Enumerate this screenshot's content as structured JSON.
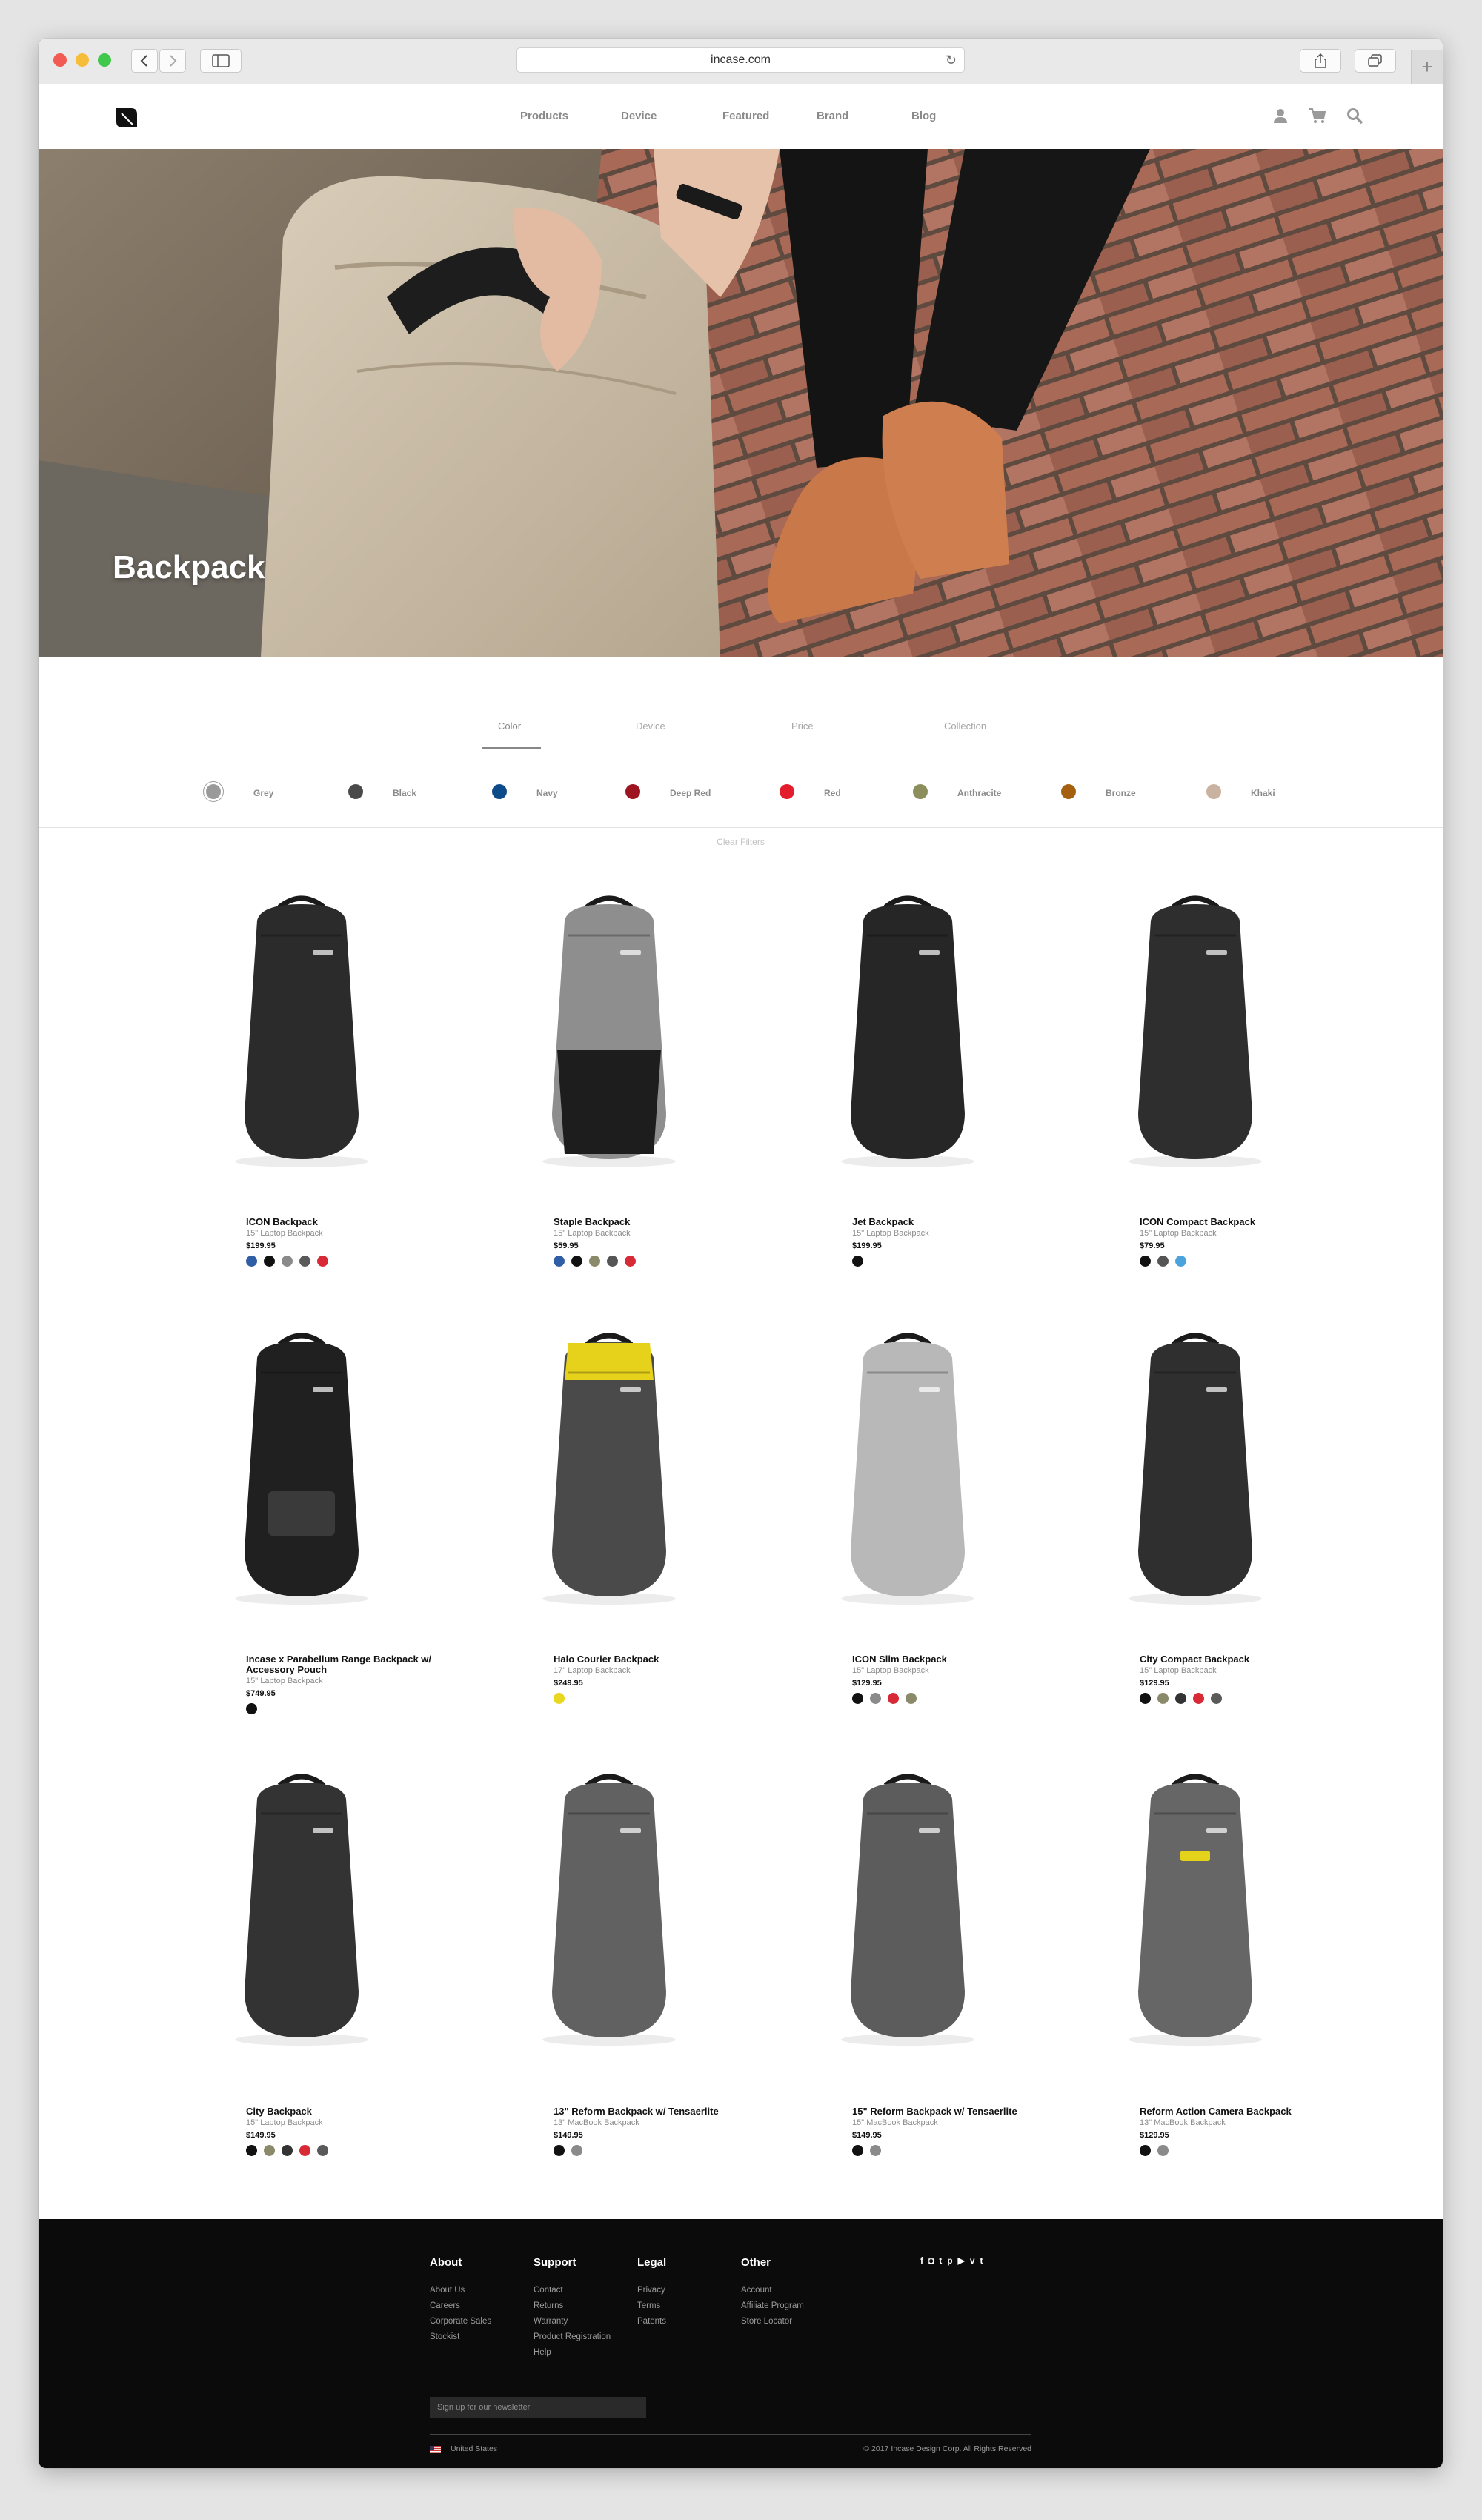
{
  "browser": {
    "url": "incase.com",
    "new_tab_symbol": "+"
  },
  "nav": {
    "links": [
      "Products",
      "Device",
      "Featured",
      "Brand",
      "Blog"
    ],
    "icons": [
      "user-icon",
      "cart-icon",
      "search-icon"
    ]
  },
  "hero": {
    "title": "Backpack"
  },
  "filters": {
    "tabs": [
      "Color",
      "Device",
      "Price",
      "Collection"
    ],
    "active_tab": "Color",
    "colors": [
      {
        "label": "Grey",
        "color": "#9a9a9a"
      },
      {
        "label": "Black",
        "color": "#4a4a4a"
      },
      {
        "label": "Navy",
        "color": "#0d4a8a"
      },
      {
        "label": "Deep Red",
        "color": "#9e1420"
      },
      {
        "label": "Red",
        "color": "#e41d2d"
      },
      {
        "label": "Anthracite",
        "color": "#8c8f5c"
      },
      {
        "label": "Bronze",
        "color": "#a5600f"
      },
      {
        "label": "Khaki",
        "color": "#c9b3a0"
      }
    ],
    "clear_label": "Clear Filters"
  },
  "products": [
    {
      "name": "ICON Backpack",
      "subtitle": "15\" Laptop Backpack",
      "price": "$199.95",
      "swatches": [
        "#2f5da6",
        "#111111",
        "#8a8a8a",
        "#5a5a5a",
        "#d82a36"
      ]
    },
    {
      "name": "Staple Backpack",
      "subtitle": "15\" Laptop Backpack",
      "price": "$59.95",
      "swatches": [
        "#2f5da6",
        "#111111",
        "#8a8a6a",
        "#555555",
        "#d82a36"
      ]
    },
    {
      "name": "Jet Backpack",
      "subtitle": "15\" Laptop Backpack",
      "price": "$199.95",
      "swatches": [
        "#111111"
      ]
    },
    {
      "name": "ICON Compact Backpack",
      "subtitle": "15\" Laptop Backpack",
      "price": "$79.95",
      "swatches": [
        "#111111",
        "#555555",
        "#4aa3dc"
      ]
    },
    {
      "name": "Incase x Parabellum Range Backpack w/ Accessory Pouch",
      "subtitle": "15\" Laptop Backpack",
      "price": "$749.95",
      "swatches": [
        "#111111"
      ]
    },
    {
      "name": "Halo Courier Backpack",
      "subtitle": "17\" Laptop Backpack",
      "price": "$249.95",
      "swatches": [
        "#e9d61e"
      ]
    },
    {
      "name": "ICON Slim Backpack",
      "subtitle": "15\" Laptop Backpack",
      "price": "$129.95",
      "swatches": [
        "#111111",
        "#8a8a8a",
        "#d82a36",
        "#8a8a6a"
      ]
    },
    {
      "name": "City Compact Backpack",
      "subtitle": "15\" Laptop Backpack",
      "price": "$129.95",
      "swatches": [
        "#111111",
        "#8a8a6a",
        "#333333",
        "#d82a36",
        "#5a5a5a"
      ]
    },
    {
      "name": "City Backpack",
      "subtitle": "15\" Laptop Backpack",
      "price": "$149.95",
      "swatches": [
        "#111111",
        "#8a8a6a",
        "#333333",
        "#d82a36",
        "#5a5a5a"
      ]
    },
    {
      "name": "13\" Reform Backpack w/ Tensaerlite",
      "subtitle": "13\" MacBook Backpack",
      "price": "$149.95",
      "swatches": [
        "#111111",
        "#8a8a8a"
      ]
    },
    {
      "name": "15\" Reform Backpack w/ Tensaerlite",
      "subtitle": "15\" MacBook Backpack",
      "price": "$149.95",
      "swatches": [
        "#111111",
        "#8a8a8a"
      ]
    },
    {
      "name": "Reform Action Camera Backpack",
      "subtitle": "13\" MacBook Backpack",
      "price": "$129.95",
      "swatches": [
        "#111111",
        "#8a8a8a"
      ]
    }
  ],
  "footer": {
    "columns": [
      {
        "heading": "About",
        "links": [
          "About Us",
          "Careers",
          "Corporate Sales",
          "Stockist"
        ]
      },
      {
        "heading": "Support",
        "links": [
          "Contact",
          "Returns",
          "Warranty",
          "Product Registration",
          "Help"
        ]
      },
      {
        "heading": "Legal",
        "links": [
          "Privacy",
          "Terms",
          "Patents"
        ]
      },
      {
        "heading": "Other",
        "links": [
          "Account",
          "Affiliate Program",
          "Store Locator"
        ]
      }
    ],
    "social": [
      "f",
      "◘",
      "t",
      "p",
      "▶",
      "v",
      "t"
    ],
    "newsletter_placeholder": "Sign up for our newsletter",
    "country": "United States",
    "copyright": "© 2017 Incase Design Corp. All Rights Reserved"
  }
}
